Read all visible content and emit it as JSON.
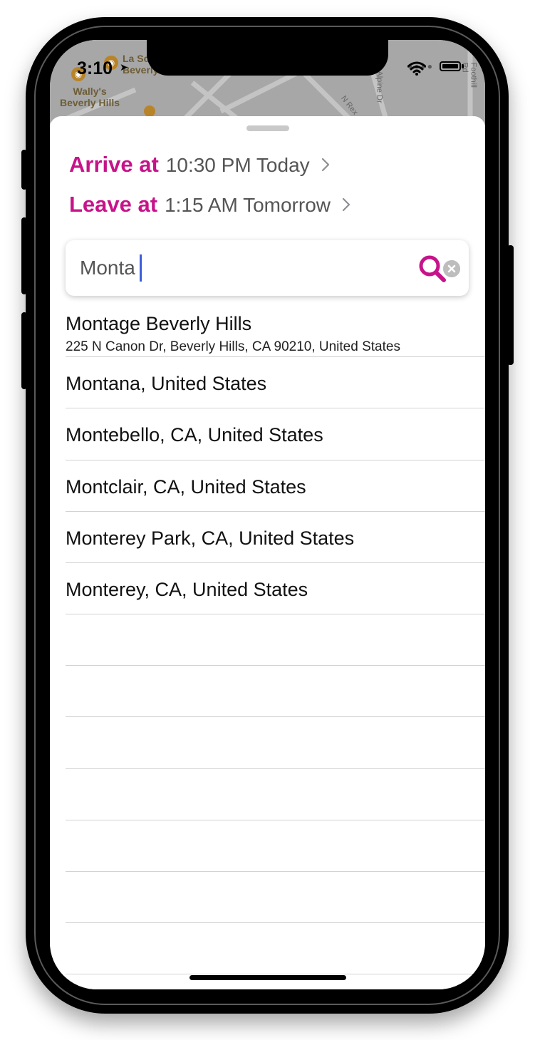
{
  "status_bar": {
    "time": "3:10",
    "location_arrow": "➤"
  },
  "map": {
    "poi_1_label": "Wally's",
    "poi_1_label_line2": "Beverly Hills",
    "poi_2_label": "La Sc",
    "poi_2_label_line2": "Beverly",
    "street_1": "N Rex",
    "street_2": "Alpine Dr",
    "street_3": "Foothill Rd"
  },
  "sheet": {
    "arrive_label": "Arrive at",
    "arrive_value": "10:30 PM Today",
    "leave_label": "Leave at",
    "leave_value": "1:15 AM Tomorrow"
  },
  "search": {
    "value": "Monta",
    "placeholder": ""
  },
  "results": [
    {
      "title": "Montage Beverly Hills",
      "subtitle": "225 N Canon Dr, Beverly Hills, CA  90210, United States"
    },
    {
      "title": "Montana, United States",
      "subtitle": ""
    },
    {
      "title": "Montebello, CA, United States",
      "subtitle": ""
    },
    {
      "title": "Montclair, CA, United States",
      "subtitle": ""
    },
    {
      "title": "Monterey Park, CA, United States",
      "subtitle": ""
    },
    {
      "title": "Monterey, CA, United States",
      "subtitle": ""
    }
  ],
  "colors": {
    "accent": "#c7138a",
    "caret": "#3a5fd9",
    "secondary_text": "#555555",
    "separator": "#d2d2d2"
  },
  "icons": {
    "search": "magnifier-icon",
    "clear": "clear-x-icon",
    "chevron": "chevron-right-icon"
  }
}
